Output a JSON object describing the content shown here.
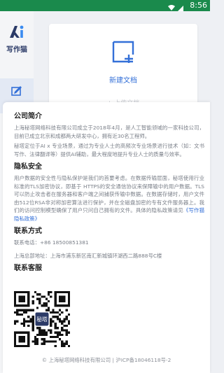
{
  "status_bar": {
    "time": "8:56"
  },
  "brand": {
    "name": "写作猫"
  },
  "card": {
    "label": "新建文档",
    "sub": "+ 上传文档"
  },
  "about": {
    "company_title": "公司简介",
    "company_p1": "上海秘塔网络科技有限公司成立于2018年4月，是人工智能领域的一家科技公司，目前已成立北京和成都两大研发中心，拥有近30名工程师。",
    "company_p2": "秘塔定位于AI x 专业场景，通过为专业人士的高频次专业场景进行技术（如：文书写作、法律翻译等）提供AI辅助，最大程度地提升专业人士的质量与效率。",
    "privacy_title": "隐私安全",
    "privacy_p": "用户数据的安全性与隐私保护是我们的首要考虑。在数据传输层面，秘塔使用行业标准的TLS加密协议，即基于 HTTPS的安全通信协议来保障输中的用户数据。TLS可以防止攻击者在服务器和客户端之间捕获传输中数据。在数据存储时，用户文件由512位RSA非对称加密算法进行保护，并在全磁盘加密的专有文件服务器上。我们的访问控制模型确保了用户只问自己拥有的文件。具体的隐私政策请见",
    "privacy_link": "《写作猫隐私政策》",
    "contact_title": "联系方式",
    "phone_label": "联系电话：",
    "phone_value": "+86 18500851381",
    "address_label": "上海总部地址：",
    "address_value": "上海市浦东新区南汇新城镇环湖西二路888号C楼",
    "service_title": "联系客服",
    "qr_center": "秘塔"
  },
  "footer": {
    "text": "© 上海秘塔网络科技有限公司 | 沪ICP备18046118号-2"
  },
  "colors": {
    "status_bar": "#1a8a4c",
    "accent": "#3470d8",
    "brand": "#2b3a67"
  }
}
